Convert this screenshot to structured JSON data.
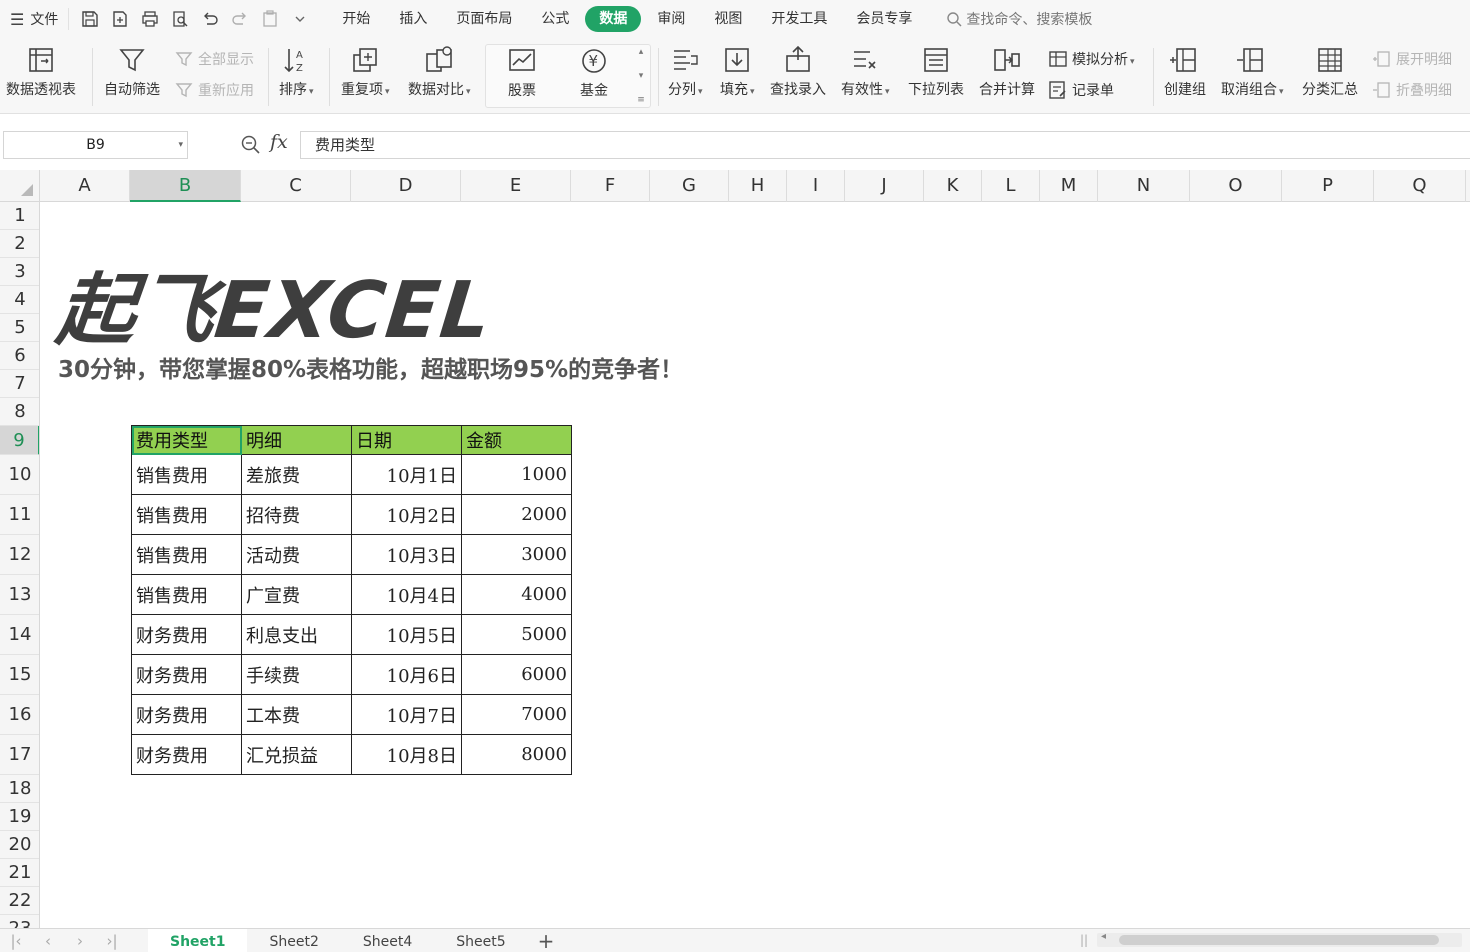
{
  "menubar": {
    "file_label": "文件",
    "tabs": [
      {
        "label": "开始",
        "active": false
      },
      {
        "label": "插入",
        "active": false
      },
      {
        "label": "页面布局",
        "active": false
      },
      {
        "label": "公式",
        "active": false
      },
      {
        "label": "数据",
        "active": true
      },
      {
        "label": "审阅",
        "active": false
      },
      {
        "label": "视图",
        "active": false
      },
      {
        "label": "开发工具",
        "active": false
      },
      {
        "label": "会员专享",
        "active": false
      }
    ],
    "search_placeholder": "查找命令、搜索模板"
  },
  "ribbon": {
    "pivot": "数据透视表",
    "autofilter": "自动筛选",
    "show_all": "全部显示",
    "reapply": "重新应用",
    "sort": "排序",
    "duplicates": "重复项",
    "compare": "数据对比",
    "stock": "股票",
    "fund": "基金",
    "split": "分列",
    "fill": "填充",
    "lookup_entry": "查找录入",
    "validation": "有效性",
    "dropdown_list": "下拉列表",
    "consolidate": "合并计算",
    "what_if": "模拟分析",
    "record_form": "记录单",
    "group": "创建组",
    "ungroup": "取消组合",
    "subtotal": "分类汇总",
    "show_detail": "展开明细",
    "hide_detail": "折叠明细"
  },
  "formula": {
    "cell_ref": "B9",
    "fx": "fx",
    "content": "费用类型"
  },
  "grid": {
    "columns": [
      "A",
      "B",
      "C",
      "D",
      "E",
      "F",
      "G",
      "H",
      "I",
      "J",
      "K",
      "L",
      "M",
      "N",
      "O",
      "P",
      "Q"
    ],
    "selected_column": "B",
    "rows": [
      "1",
      "2",
      "3",
      "4",
      "5",
      "6",
      "7",
      "8",
      "9",
      "10",
      "11",
      "12",
      "13",
      "14",
      "15",
      "16",
      "17",
      "18",
      "19",
      "20",
      "21",
      "22",
      "23"
    ],
    "selected_row": "9"
  },
  "banner": {
    "title": "起飞EXCEL",
    "subtitle": "30分钟，带您掌握80%表格功能，超越职场95%的竞争者！"
  },
  "table": {
    "headers": [
      "费用类型",
      "明细",
      "日期",
      "金额"
    ],
    "rows": [
      [
        "销售费用",
        "差旅费",
        "10月1日",
        "1000"
      ],
      [
        "销售费用",
        "招待费",
        "10月2日",
        "2000"
      ],
      [
        "销售费用",
        "活动费",
        "10月3日",
        "3000"
      ],
      [
        "销售费用",
        "广宣费",
        "10月4日",
        "4000"
      ],
      [
        "财务费用",
        "利息支出",
        "10月5日",
        "5000"
      ],
      [
        "财务费用",
        "手续费",
        "10月6日",
        "6000"
      ],
      [
        "财务费用",
        "工本费",
        "10月7日",
        "7000"
      ],
      [
        "财务费用",
        "汇兑损益",
        "10月8日",
        "8000"
      ]
    ],
    "header_color": "#92d050"
  },
  "sheets": [
    {
      "label": "Sheet1",
      "active": true
    },
    {
      "label": "Sheet2",
      "active": false
    },
    {
      "label": "Sheet4",
      "active": false
    },
    {
      "label": "Sheet5",
      "active": false
    }
  ],
  "colors": {
    "accent": "#21a366"
  }
}
